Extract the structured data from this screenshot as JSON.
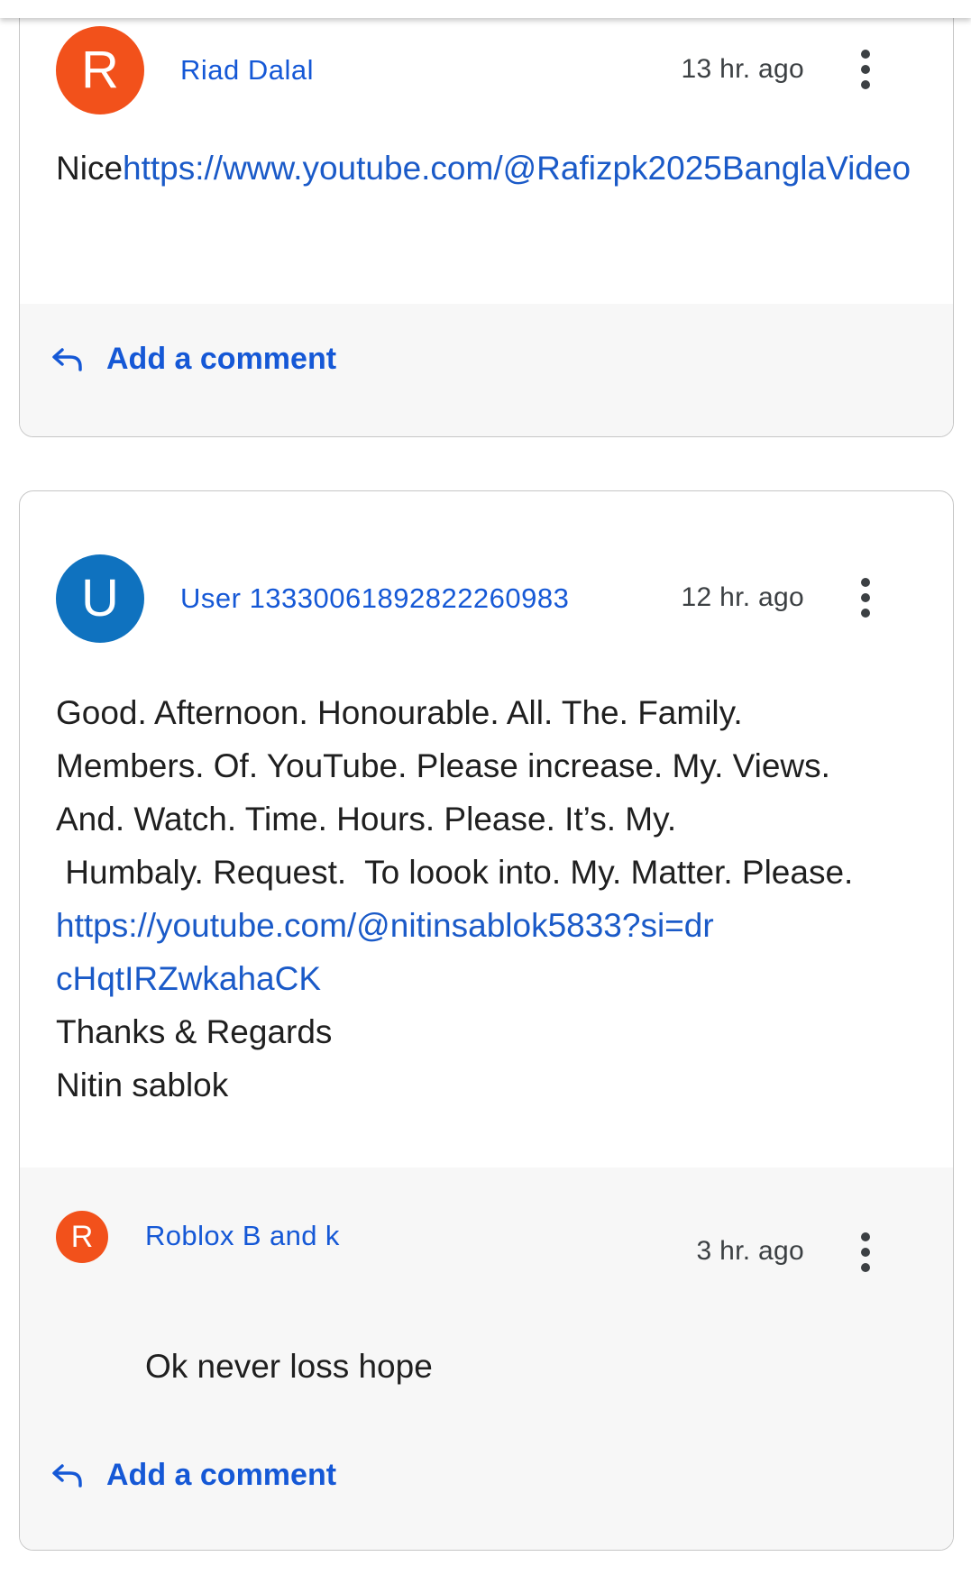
{
  "comments": [
    {
      "avatar_letter": "R",
      "avatar_color": "#f2511b",
      "author": "Riad Dalal",
      "time": "13 hr. ago",
      "text_prefix": "Nice",
      "link": "https://www.youtube.com/@Rafizpk2025BanglaVideo",
      "footer_action": "Add a comment"
    },
    {
      "avatar_letter": "U",
      "avatar_color": "#0f72bf",
      "author": "User 13330061892822260983",
      "time": "12 hr. ago",
      "lines": [
        "Good.  Afternoon. Honourable. All. The. Family.",
        "Members.  Of.  YouTube. Please increase.  My.  Views.",
        "And.  Watch. Time.  Hours.  Please.  It’s.  My.",
        " Humbaly. Request.  To loook into. My. Matter. Please."
      ],
      "link": "https://youtube.com/@nitinsablok5833?si=drcHqtIRZwkahaCK",
      "closing": "Thanks & Regards",
      "signature": "Nitin sablok",
      "reply": {
        "avatar_letter": "R",
        "avatar_color": "#f2511b",
        "author": "Roblox B and k",
        "time": "3 hr. ago",
        "text": "Ok never loss hope"
      },
      "footer_action": "Add a comment"
    }
  ],
  "icons": {
    "reply": "reply-arrow-icon",
    "menu": "more-vert-icon"
  }
}
